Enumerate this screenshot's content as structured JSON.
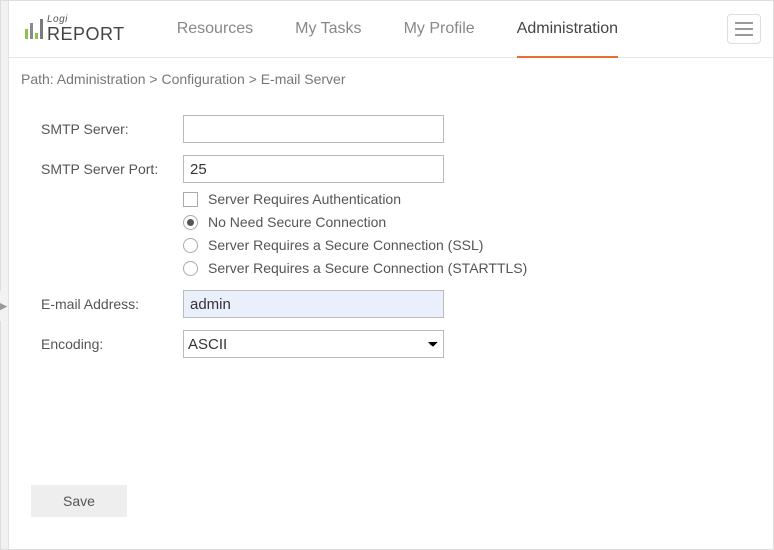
{
  "logo": {
    "top": "Logi",
    "bottom": "REPORT"
  },
  "nav": {
    "items": [
      {
        "label": "Resources",
        "name": "nav-resources",
        "active": false
      },
      {
        "label": "My Tasks",
        "name": "nav-my-tasks",
        "active": false
      },
      {
        "label": "My Profile",
        "name": "nav-my-profile",
        "active": false
      },
      {
        "label": "Administration",
        "name": "nav-administration",
        "active": true
      }
    ]
  },
  "breadcrumb": "Path: Administration > Configuration > E-mail Server",
  "form": {
    "smtp_server": {
      "label": "SMTP Server:",
      "value": ""
    },
    "smtp_port": {
      "label": "SMTP Server Port:",
      "value": "25"
    },
    "auth_checkbox": {
      "label": "Server Requires Authentication",
      "checked": false
    },
    "security": {
      "selected": "none",
      "options": [
        {
          "key": "none",
          "label": "No Need Secure Connection"
        },
        {
          "key": "ssl",
          "label": "Server Requires a Secure Connection (SSL)"
        },
        {
          "key": "starttls",
          "label": "Server Requires a Secure Connection (STARTTLS)"
        }
      ]
    },
    "email": {
      "label": "E-mail Address:",
      "value": "admin"
    },
    "encoding": {
      "label": "Encoding:",
      "value": "ASCII",
      "options": [
        "ASCII"
      ]
    }
  },
  "buttons": {
    "save": "Save"
  }
}
